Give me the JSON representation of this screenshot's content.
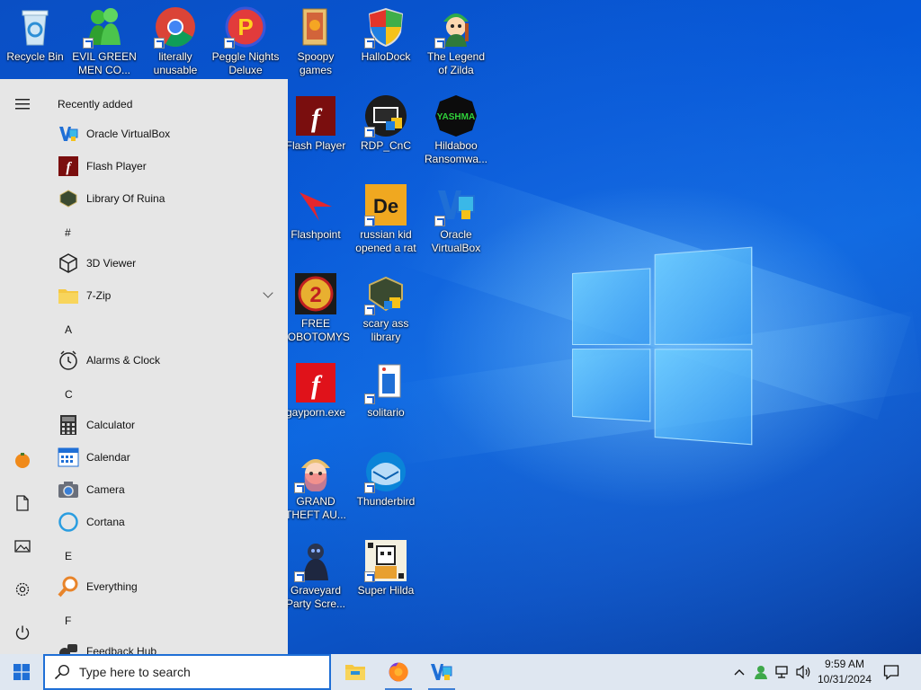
{
  "desktop": {
    "icons": [
      {
        "label": "Recycle Bin"
      },
      {
        "label": "EVIL GREEN MEN CO..."
      },
      {
        "label": "literally unusable"
      },
      {
        "label": "Peggle Nights Deluxe"
      },
      {
        "label": "Spoopy games"
      },
      {
        "label": "HalloDock"
      },
      {
        "label": "The Legend of Zilda"
      },
      {
        "label": "Flash Player"
      },
      {
        "label": "RDP_CnC"
      },
      {
        "label": "Hildaboo Ransomwa..."
      },
      {
        "label": "Flashpoint"
      },
      {
        "label": "russian kid opened a rat"
      },
      {
        "label": "Oracle VirtualBox"
      },
      {
        "label": "FREE LOBOTOMYS"
      },
      {
        "label": "scary ass library"
      },
      {
        "label": "gayporn.exe"
      },
      {
        "label": "solitario"
      },
      {
        "label": "GRAND THEFT AU..."
      },
      {
        "label": "Thunderbird"
      },
      {
        "label": "Graveyard Party Scre..."
      },
      {
        "label": "Super Hilda"
      }
    ],
    "icon_badge_text": {
      "hildaboo": "YASHMA",
      "russian": "De"
    }
  },
  "start_menu": {
    "header": "Recently added",
    "items": [
      {
        "label": "Oracle VirtualBox"
      },
      {
        "label": "Flash Player"
      },
      {
        "label": "Library Of Ruina"
      },
      {
        "label": "#"
      },
      {
        "label": "3D Viewer"
      },
      {
        "label": "7-Zip"
      },
      {
        "label": "A"
      },
      {
        "label": "Alarms & Clock"
      },
      {
        "label": "C"
      },
      {
        "label": "Calculator"
      },
      {
        "label": "Calendar"
      },
      {
        "label": "Camera"
      },
      {
        "label": "Cortana"
      },
      {
        "label": "E"
      },
      {
        "label": "Everything"
      },
      {
        "label": "F"
      },
      {
        "label": "Feedback Hub"
      }
    ],
    "rail_icons": [
      "hamburger-icon",
      "user-avatar-icon",
      "documents-icon",
      "pictures-icon",
      "settings-icon",
      "power-icon"
    ]
  },
  "taskbar": {
    "search_placeholder": "Type here to search",
    "apps": [
      "file-explorer-icon",
      "firefox-icon",
      "virtualbox-icon"
    ],
    "clock_time": "9:59 AM",
    "clock_date": "10/31/2024",
    "accent": "#1f6fd6"
  }
}
